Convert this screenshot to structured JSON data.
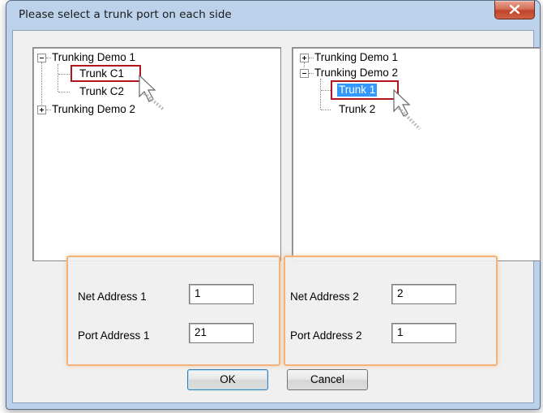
{
  "dialog": {
    "title": "Please select a trunk port on each side"
  },
  "left_tree": {
    "nodes": [
      {
        "label": "Trunking Demo 1",
        "state": "expanded"
      },
      {
        "label": "Trunk C1",
        "state": "highlighted"
      },
      {
        "label": "Trunk C2",
        "state": "leaf"
      },
      {
        "label": "Trunking Demo 2",
        "state": "collapsed"
      }
    ]
  },
  "right_tree": {
    "nodes": [
      {
        "label": "Trunking Demo 1",
        "state": "collapsed"
      },
      {
        "label": "Trunking Demo 2",
        "state": "expanded"
      },
      {
        "label": "Trunk 1",
        "state": "selected"
      },
      {
        "label": "Trunk 2",
        "state": "leaf"
      }
    ]
  },
  "side1": {
    "net_label": "Net Address 1",
    "net_value": "1",
    "port_label": "Port Address 1",
    "port_value": "21"
  },
  "side2": {
    "net_label": "Net Address 2",
    "net_value": "2",
    "port_label": "Port Address 2",
    "port_value": "1"
  },
  "buttons": {
    "ok": "OK",
    "cancel": "Cancel"
  },
  "colors": {
    "highlight_box": "#b0161c",
    "selection": "#3399ff",
    "group_outline": "#f4b27a",
    "close_button": "#c1442a"
  }
}
